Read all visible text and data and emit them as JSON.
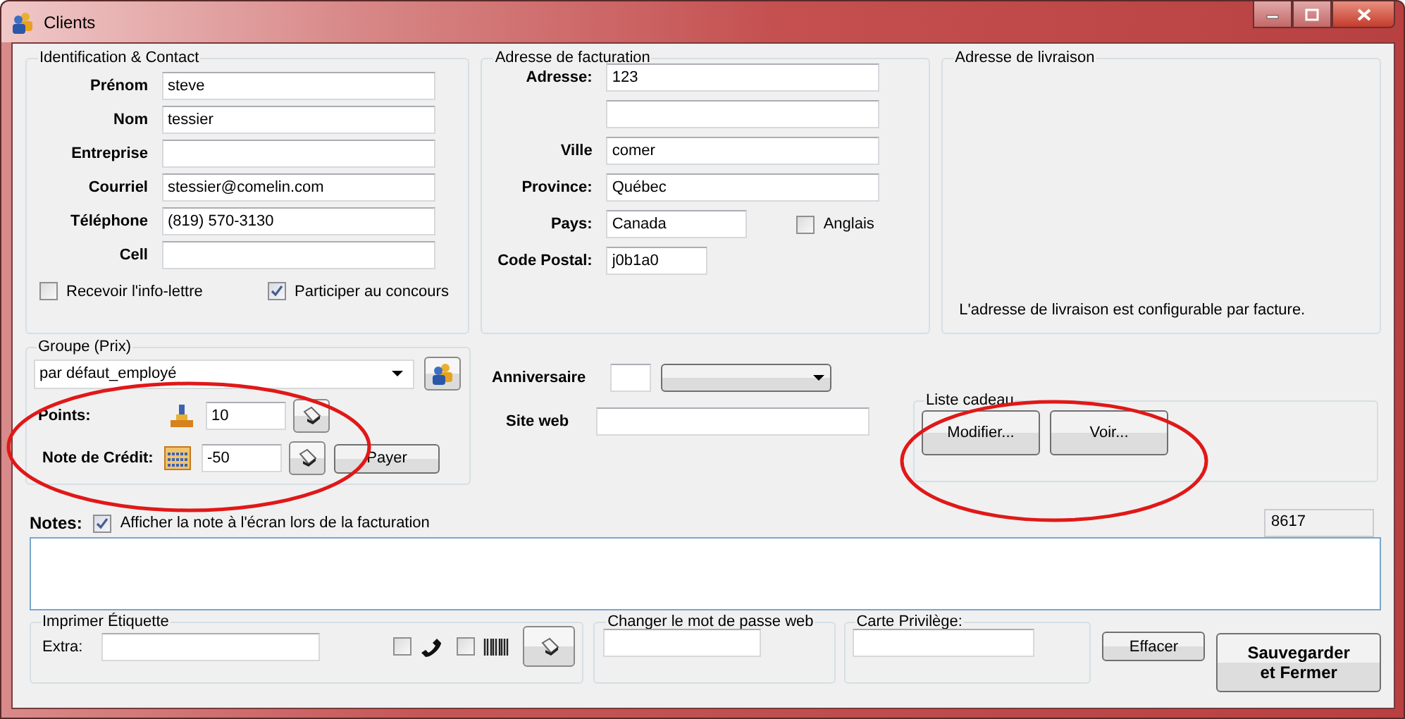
{
  "window": {
    "title": "Clients"
  },
  "identification": {
    "title": "Identification & Contact",
    "fields": [
      {
        "label": "Prénom",
        "value": "steve"
      },
      {
        "label": "Nom",
        "value": "tessier"
      },
      {
        "label": "Entreprise"
      },
      {
        "label": "Courriel",
        "value": "stessier@comelin.com"
      },
      {
        "label": "Téléphone",
        "value": "(819) 570-3130"
      },
      {
        "label": "Cell"
      }
    ],
    "checkboxes": [
      {
        "label": "Recevoir l'info-lettre",
        "checked": false
      },
      {
        "label": "Participer au concours",
        "checked": true
      }
    ]
  },
  "billing_address": {
    "title": "Adresse de facturation",
    "fields": [
      {
        "label": "Adresse:",
        "value": "123",
        "kind": "full"
      },
      {
        "kind": "full"
      },
      {
        "label": "Ville",
        "value": "comer",
        "kind": "full"
      },
      {
        "label": "Province:",
        "value": "Québec",
        "kind": "full"
      },
      {
        "label": "Pays:",
        "value": "Canada",
        "kind": "short"
      },
      {
        "label": "Code Postal:",
        "value": "j0b1a0",
        "kind": "shorter"
      }
    ],
    "language_checkbox": {
      "label": "Anglais",
      "checked": false
    }
  },
  "shipping_address": {
    "title": "Adresse de livraison",
    "note": "L'adresse de livraison est configurable par facture."
  },
  "price_group": {
    "title": "Groupe (Prix)",
    "selection": "par défaut_employé",
    "points": {
      "label": "Points:",
      "value": "10"
    },
    "credit": {
      "label": "Note de Crédit:",
      "value": "-50",
      "button": "Payer"
    }
  },
  "anniversary": {
    "label": "Anniversaire"
  },
  "website": {
    "label": "Site web"
  },
  "gift_list": {
    "title": "Liste cadeau",
    "buttons": [
      "Modifier...",
      "Voir..."
    ]
  },
  "notes": {
    "label": "Notes:",
    "checkbox": {
      "label": "Afficher la note à l'écran lors de la facturation",
      "checked": true
    },
    "number": "8617"
  },
  "print_label": {
    "title": "Imprimer Étiquette",
    "extra_label": "Extra:",
    "checkboxes": [
      {
        "kind": "phone",
        "checked": false
      },
      {
        "kind": "barcode",
        "checked": false
      }
    ]
  },
  "web_password": {
    "title": "Changer le mot de passe web"
  },
  "privilege_card": {
    "title": "Carte Privilège:"
  },
  "buttons": [
    {
      "kind": "clear",
      "label": "Effacer"
    },
    {
      "kind": "save",
      "label": "Sauvegarder et Fermer"
    }
  ]
}
